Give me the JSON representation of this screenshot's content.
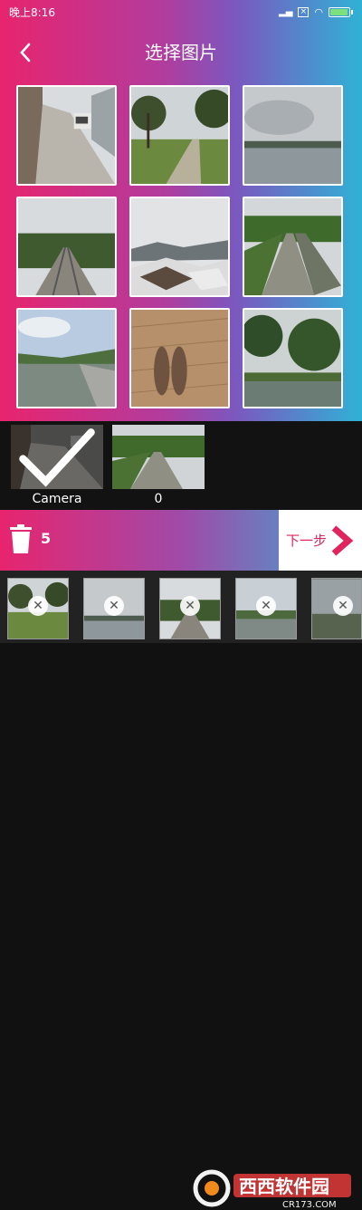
{
  "status_bar": {
    "time": "晚上8:16",
    "signal_box": "×"
  },
  "header": {
    "title": "选择图片",
    "back_icon": "chevron-left-icon"
  },
  "grid": {
    "photos": [
      "alley-with-parked-car",
      "park-path-with-trees",
      "lake-overcast-sky",
      "railway-track-with-trees",
      "snowy-rooftops-mountains",
      "railway-track-with-platform",
      "canal-river-hills",
      "shadow-on-tiled-floor",
      "pond-with-trees"
    ]
  },
  "albums": [
    {
      "name": "Camera",
      "selected": true
    },
    {
      "name": "0",
      "selected": false
    }
  ],
  "action_bar": {
    "count": "5",
    "next_label": "下一步"
  },
  "selected_strip": [
    "park-path",
    "lake",
    "railway-track",
    "river",
    "partial"
  ],
  "watermark": {
    "brand": "西西软件园",
    "url": "CR173.COM"
  },
  "colors": {
    "pink": "#e8246e",
    "cyan": "#2fb2d6",
    "next_text": "#e0245e"
  }
}
